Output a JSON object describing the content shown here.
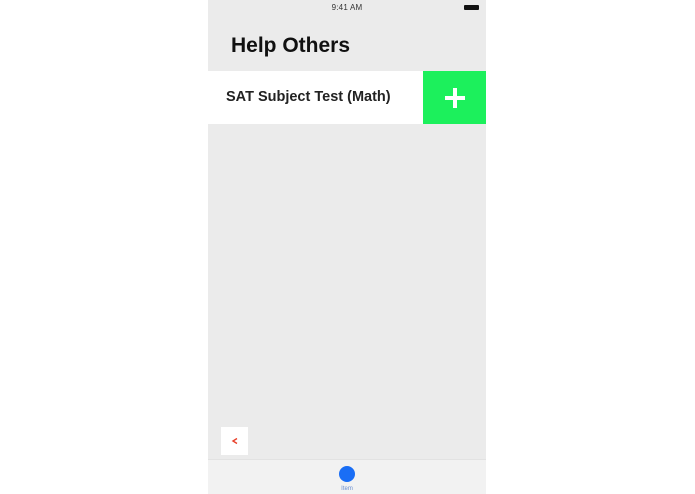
{
  "status_bar": {
    "time": "9:41 AM"
  },
  "header": {
    "title": "Help Others"
  },
  "subjects": [
    {
      "label": "SAT Subject Test (Math)",
      "action_icon": "plus-icon",
      "action_color": "#1cf05c"
    }
  ],
  "back_button": {
    "icon": "chevron-left-icon",
    "color": "#e8402a"
  },
  "tab_bar": {
    "items": [
      {
        "label": "Item",
        "icon": "circle-icon",
        "color": "#1a6ef5"
      }
    ]
  },
  "colors": {
    "background": "#ebebeb",
    "accent_green": "#1cf05c",
    "accent_blue": "#1a6ef5"
  }
}
